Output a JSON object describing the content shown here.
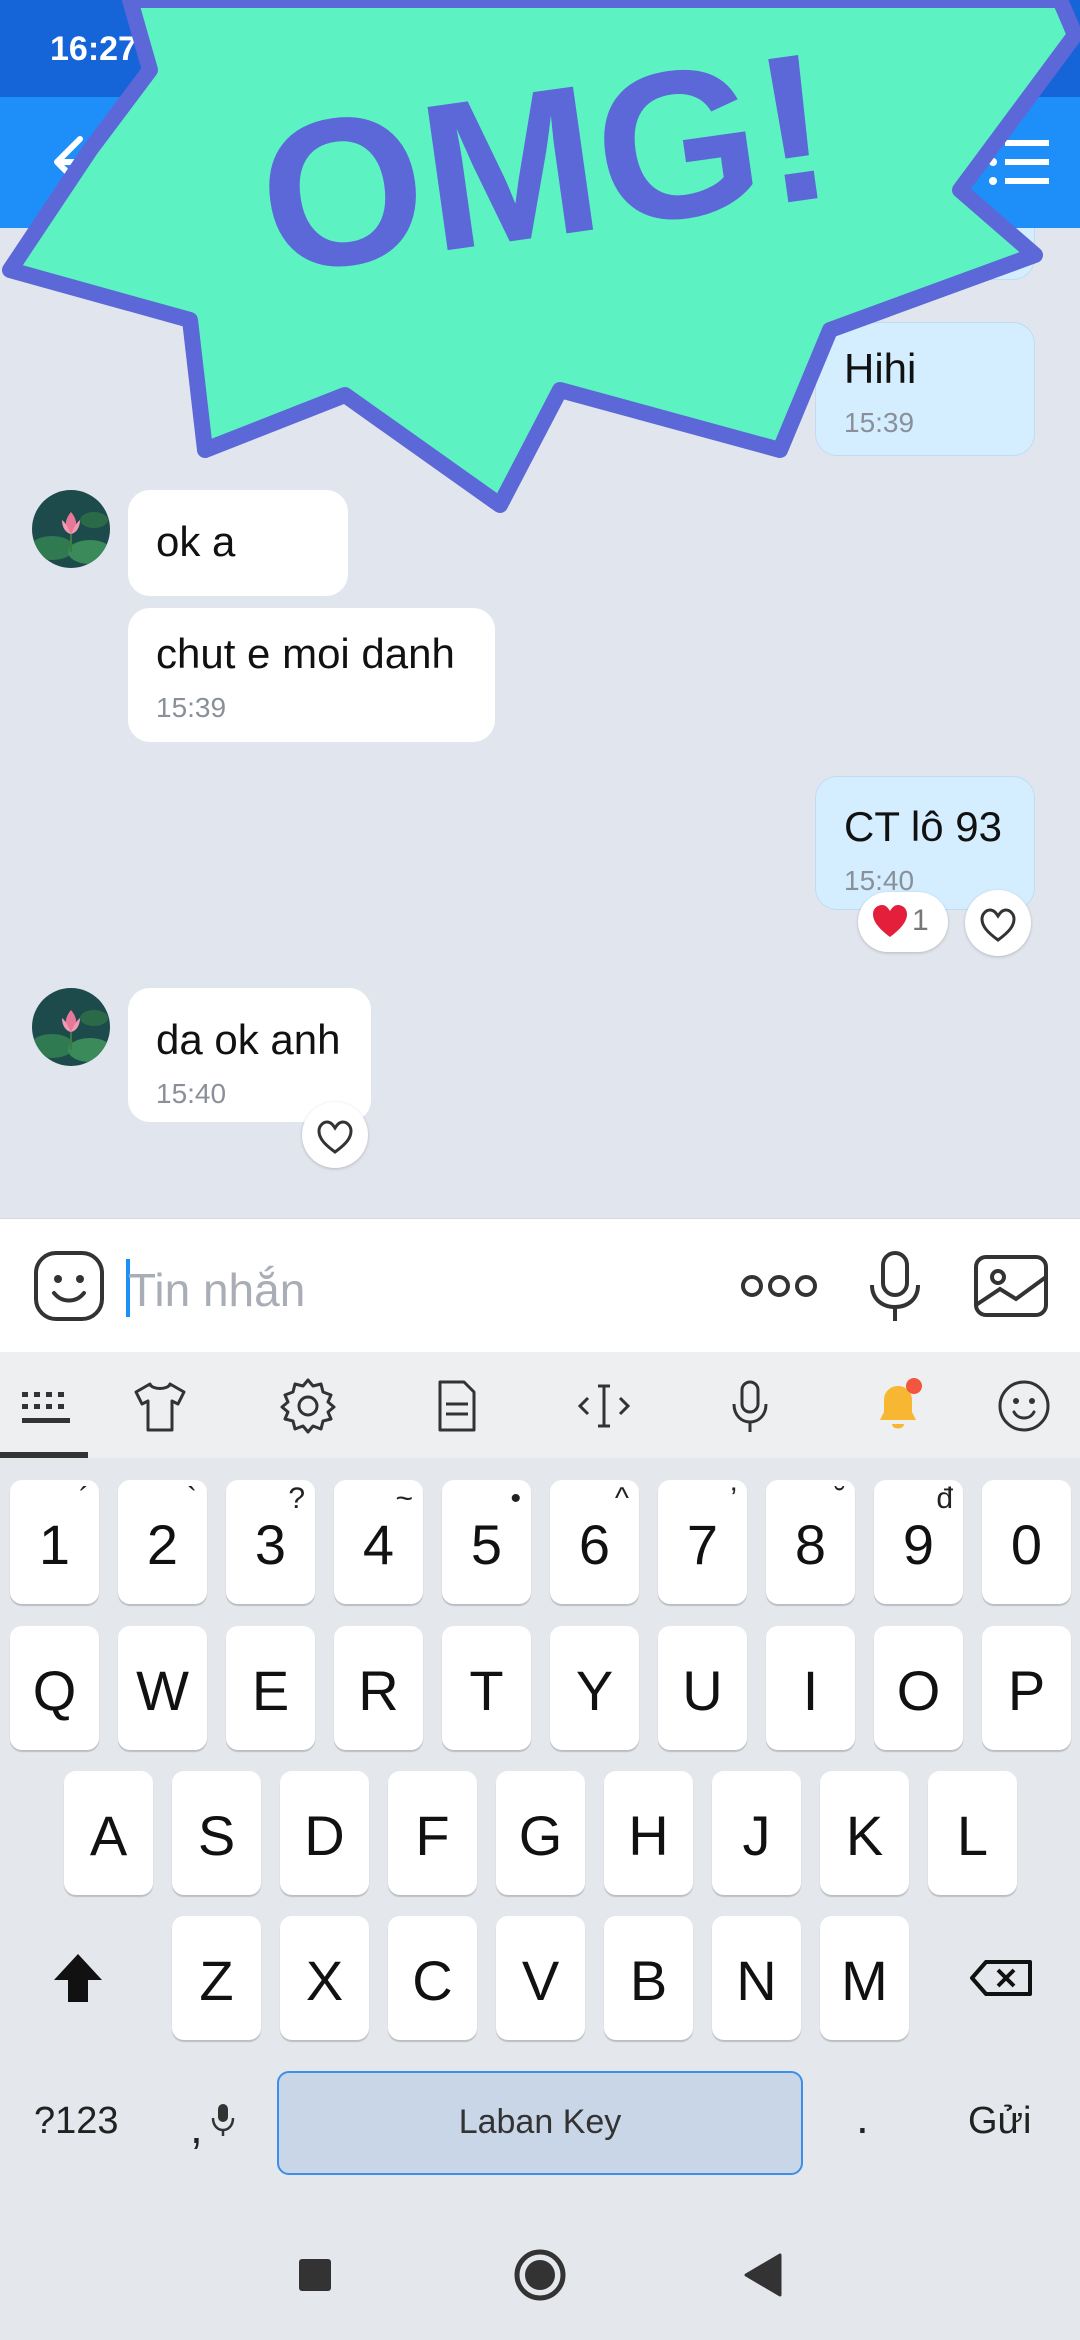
{
  "status_bar": {
    "time": "16:27"
  },
  "sticker": {
    "text": "OMG!"
  },
  "messages": [
    {
      "text": "Hihi",
      "time": "15:39"
    },
    {
      "text": "ok a"
    },
    {
      "text": "chut e moi danh",
      "time": "15:39"
    },
    {
      "text": "CT lô 93",
      "time": "15:40",
      "reaction_count": "1"
    },
    {
      "text": "da ok anh",
      "time": "15:40"
    }
  ],
  "composer": {
    "placeholder": "Tin nhắn"
  },
  "keyboard": {
    "number_row": [
      "1",
      "2",
      "3",
      "4",
      "5",
      "6",
      "7",
      "8",
      "9",
      "0"
    ],
    "number_hints": [
      "´",
      "`",
      "?",
      "~",
      "•",
      "^",
      "’",
      "˘",
      "đ",
      ""
    ],
    "row1": [
      "Q",
      "W",
      "E",
      "R",
      "T",
      "Y",
      "U",
      "I",
      "O",
      "P"
    ],
    "row2": [
      "A",
      "S",
      "D",
      "F",
      "G",
      "H",
      "J",
      "K",
      "L"
    ],
    "row3": [
      "Z",
      "X",
      "C",
      "V",
      "B",
      "N",
      "M"
    ],
    "symbols_key": "?123",
    "comma_key": ",",
    "space_label": "Laban Key",
    "period_key": ".",
    "send_key": "Gửi"
  },
  "colors": {
    "header": "#1e8ff8",
    "status_bar": "#1565d8",
    "sticker_fill": "#5cf2c2",
    "sticker_ink": "#5c67d8"
  }
}
